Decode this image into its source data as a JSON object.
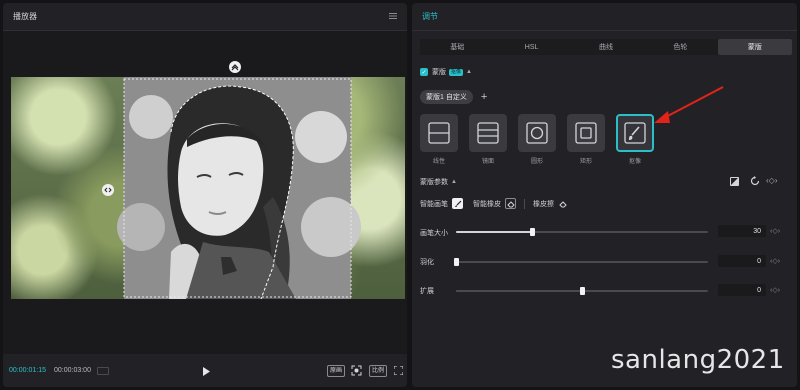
{
  "player": {
    "title": "播放器",
    "menu_icon": "hamburger-menu-icon",
    "current_time": "00:00:01:15",
    "total_time": "00:00:03:00",
    "buttons": {
      "play": "play-icon",
      "original": "原画",
      "fit": "focus-icon",
      "ratio": "比例",
      "fullscreen": "fullscreen-icon"
    }
  },
  "adjust": {
    "title": "调节",
    "tabs": [
      "基础",
      "HSL",
      "曲线",
      "色轮",
      "蒙版"
    ],
    "active_tab": "蒙版",
    "mask_header": {
      "label": "蒙版",
      "badge": "抠像"
    },
    "mask_chip": "蒙版1 自定义",
    "add_icon": "plus-icon",
    "mask_types": [
      {
        "label": "线性",
        "icon": "linear-mask-icon"
      },
      {
        "label": "镜面",
        "icon": "mirror-mask-icon"
      },
      {
        "label": "圆形",
        "icon": "circle-mask-icon"
      },
      {
        "label": "矩形",
        "icon": "rectangle-mask-icon"
      },
      {
        "label": "抠像",
        "icon": "brush-mask-icon",
        "selected": true
      }
    ],
    "params": {
      "title": "蒙版参数",
      "smart_brush": "智能画笔",
      "smart_eraser": "智能橡皮",
      "eraser": "橡皮擦",
      "brush_size": {
        "label": "画笔大小",
        "value": "30",
        "level": 0.3
      },
      "feather": {
        "label": "羽化",
        "value": "0",
        "level": 0.0
      },
      "expand": {
        "label": "扩展",
        "value": "0",
        "level": 0.5
      }
    },
    "accent_color": "#2bc0c9"
  },
  "watermark": "sanlang2021"
}
